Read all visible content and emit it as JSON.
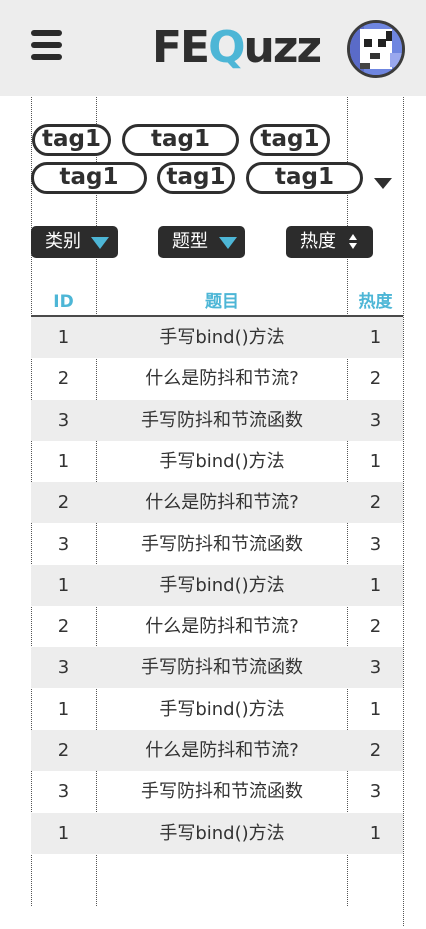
{
  "header": {
    "logo_prefix": "FE",
    "logo_accent": "Q",
    "logo_suffix": "uzz",
    "colors": {
      "background": "#ededed",
      "accent": "#4db6d6",
      "text": "#2f2f2f"
    }
  },
  "tags": [
    "tag1",
    "tag1",
    "tag1",
    "tag1",
    "tag1",
    "tag1"
  ],
  "filters": {
    "category_label": "类别",
    "type_label": "题型",
    "hot_label": "热度"
  },
  "table": {
    "headers": {
      "id": "ID",
      "title": "题目",
      "hot": "热度"
    },
    "rows": [
      {
        "id": "1",
        "title": "手写bind()方法",
        "hot": "1"
      },
      {
        "id": "2",
        "title": "什么是防抖和节流?",
        "hot": "2"
      },
      {
        "id": "3",
        "title": "手写防抖和节流函数",
        "hot": "3"
      },
      {
        "id": "1",
        "title": "手写bind()方法",
        "hot": "1"
      },
      {
        "id": "2",
        "title": "什么是防抖和节流?",
        "hot": "2"
      },
      {
        "id": "3",
        "title": "手写防抖和节流函数",
        "hot": "3"
      },
      {
        "id": "1",
        "title": "手写bind()方法",
        "hot": "1"
      },
      {
        "id": "2",
        "title": "什么是防抖和节流?",
        "hot": "2"
      },
      {
        "id": "3",
        "title": "手写防抖和节流函数",
        "hot": "3"
      },
      {
        "id": "1",
        "title": "手写bind()方法",
        "hot": "1"
      },
      {
        "id": "2",
        "title": "什么是防抖和节流?",
        "hot": "2"
      },
      {
        "id": "3",
        "title": "手写防抖和节流函数",
        "hot": "3"
      },
      {
        "id": "1",
        "title": "手写bind()方法",
        "hot": "1"
      }
    ]
  }
}
